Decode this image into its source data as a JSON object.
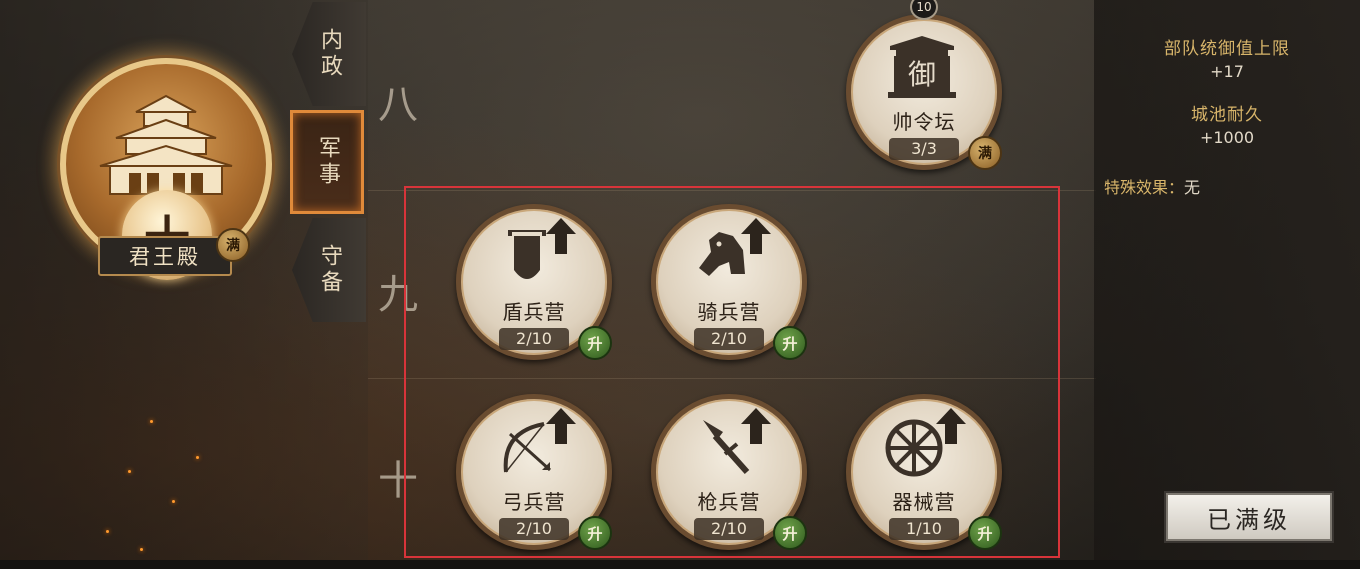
{
  "main_building": {
    "name": "君王殿",
    "level": "十",
    "status_badge": "满"
  },
  "tabs": [
    {
      "label": "内政",
      "active": false
    },
    {
      "label": "军事",
      "active": true
    },
    {
      "label": "守备",
      "active": false
    }
  ],
  "tiers": [
    "八",
    "九",
    "十"
  ],
  "buildings": [
    {
      "name": "帅令坛",
      "count": "3/3",
      "badge": "满",
      "top_badge": "10",
      "icon": "altar-icon"
    },
    {
      "name": "盾兵营",
      "count": "2/10",
      "badge": "升",
      "icon": "shield-icon"
    },
    {
      "name": "骑兵营",
      "count": "2/10",
      "badge": "升",
      "icon": "horse-icon"
    },
    {
      "name": "弓兵营",
      "count": "2/10",
      "badge": "升",
      "icon": "bow-icon"
    },
    {
      "name": "枪兵营",
      "count": "2/10",
      "badge": "升",
      "icon": "spear-icon"
    },
    {
      "name": "器械营",
      "count": "1/10",
      "badge": "升",
      "icon": "wheel-icon"
    }
  ],
  "info": {
    "stat1_label": "部队统御值上限",
    "stat1_value": "+17",
    "stat2_label": "城池耐久",
    "stat2_value": "+1000",
    "special_label": "特殊效果：",
    "special_value": "无"
  },
  "maxed_button": "已满级",
  "colors": {
    "accent_orange": "#e08a3a",
    "highlight_red": "#d8343a",
    "upgrade_green": "#3f7a2a",
    "gold_text": "#d8b56a"
  }
}
